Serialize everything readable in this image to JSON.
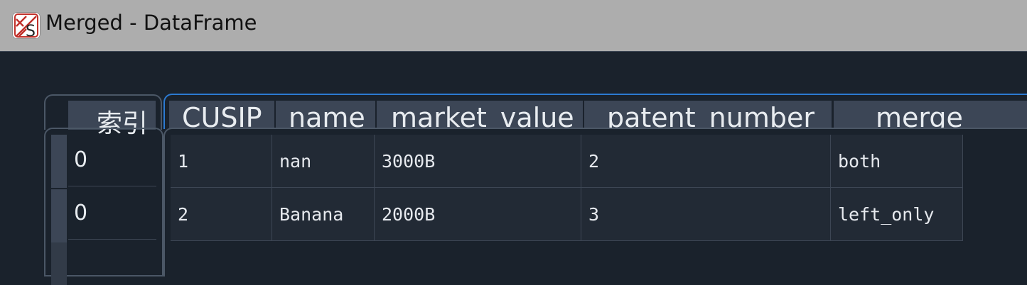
{
  "window": {
    "title": "Merged - DataFrame"
  },
  "app_icon": "ks-spreadsheet-icon",
  "index_header": "索引",
  "columns": [
    "CUSIP",
    "name",
    "market_value",
    "patent_number",
    "_merge"
  ],
  "index": [
    "0",
    "0"
  ],
  "rows": [
    [
      "1",
      "nan",
      "3000B",
      "2",
      "both"
    ],
    [
      "2",
      "Banana",
      "2000B",
      "3",
      "left_only"
    ]
  ],
  "colors": {
    "accent": "#2c7ad1",
    "background": "#1a222c",
    "header": "#3c4656",
    "titlebar": "#adadad"
  }
}
